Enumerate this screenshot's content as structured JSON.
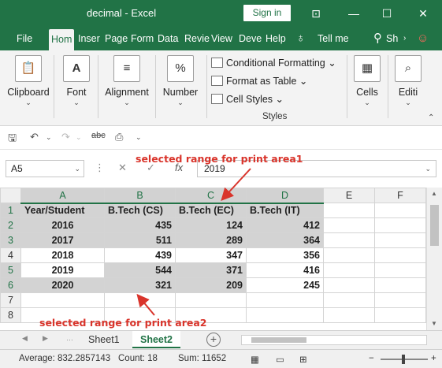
{
  "window": {
    "title": "decimal  -  Excel",
    "signin": "Sign in"
  },
  "tabs": [
    "File",
    "Hom",
    "Inser",
    "Page",
    "Form",
    "Data",
    "Revie",
    "View",
    "Deve",
    "Help",
    "Tell me",
    "Sh"
  ],
  "ribbon": {
    "clipboard": "Clipboard",
    "font": "Font",
    "alignment": "Alignment",
    "number": "Number",
    "number_glyph": "%",
    "conditional": "Conditional Formatting",
    "format_table": "Format as Table",
    "cell_styles": "Cell Styles",
    "styles_group": "Styles",
    "cells": "Cells",
    "editing": "Editi"
  },
  "formula_bar": {
    "name_box": "A5",
    "fx": "fx",
    "value": "2019"
  },
  "columns": [
    "A",
    "B",
    "C",
    "D",
    "E",
    "F"
  ],
  "rows": [
    {
      "num": "1",
      "a": "Year/Student",
      "b": "B.Tech (CS)",
      "c": "B.Tech (EC)",
      "d": "B.Tech (IT)"
    },
    {
      "num": "2",
      "a": "2016",
      "b": "435",
      "c": "124",
      "d": "412"
    },
    {
      "num": "3",
      "a": "2017",
      "b": "511",
      "c": "289",
      "d": "364"
    },
    {
      "num": "4",
      "a": "2018",
      "b": "439",
      "c": "347",
      "d": "356"
    },
    {
      "num": "5",
      "a": "2019",
      "b": "544",
      "c": "371",
      "d": "416"
    },
    {
      "num": "6",
      "a": "2020",
      "b": "321",
      "c": "209",
      "d": "245"
    },
    {
      "num": "7",
      "a": "",
      "b": "",
      "c": "",
      "d": ""
    },
    {
      "num": "8",
      "a": "",
      "b": "",
      "c": "",
      "d": ""
    }
  ],
  "annotations": {
    "area1": "selected range for print area1",
    "area2": "selected range for print area2"
  },
  "sheets": [
    "Sheet1",
    "Sheet2"
  ],
  "status": {
    "average": "Average: 832.2857143",
    "count": "Count: 18",
    "sum": "Sum: 11652"
  },
  "colors": {
    "excel_green": "#217346",
    "selection": "#d3d3d3",
    "annotation": "#d9342b"
  },
  "icons": [
    "minimize-icon",
    "maximize-icon",
    "close-icon",
    "ribbon-display-icon",
    "lightbulb-icon",
    "share-icon",
    "smiley-icon",
    "save-icon",
    "undo-icon",
    "redo-icon",
    "spelling-icon",
    "add-sheet-icon"
  ]
}
